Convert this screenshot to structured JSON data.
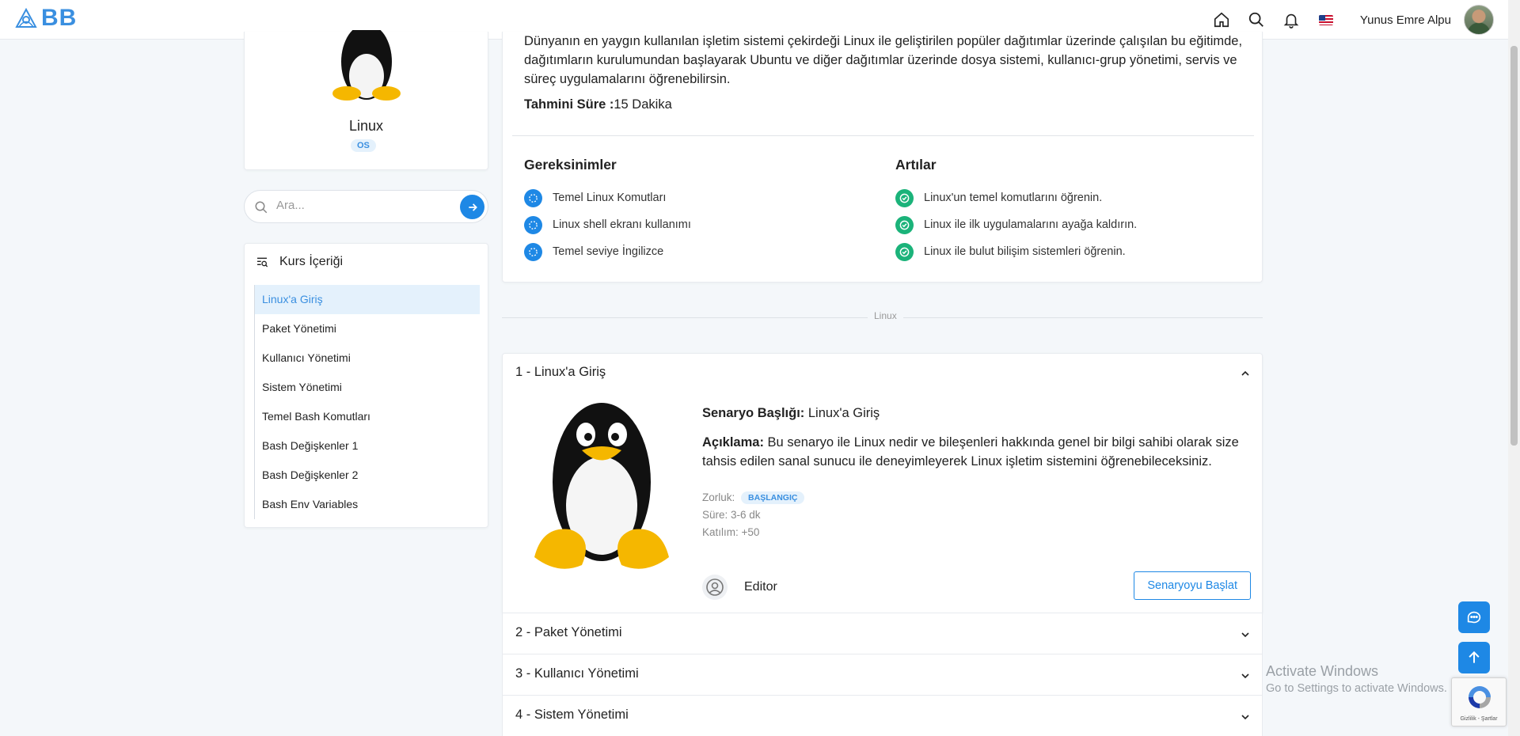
{
  "navbar": {
    "logo_text": "BB",
    "user_name": "Yunus Emre Alpu"
  },
  "course": {
    "title": "Linux",
    "badge": "OS"
  },
  "search": {
    "placeholder": "Ara..."
  },
  "content": {
    "title": "Kurs İçeriği",
    "items": [
      {
        "label": "Linux'a Giriş",
        "active": true
      },
      {
        "label": "Paket Yönetimi"
      },
      {
        "label": "Kullanıcı Yönetimi"
      },
      {
        "label": "Sistem Yönetimi"
      },
      {
        "label": "Temel Bash Komutları"
      },
      {
        "label": "Bash Değişkenler 1"
      },
      {
        "label": "Bash Değişkenler 2"
      },
      {
        "label": "Bash Env Variables"
      }
    ]
  },
  "info": {
    "description": "Dünyanın en yaygın kullanılan işletim sistemi çekirdeği Linux ile geliştirilen popüler dağıtımlar üzerinde çalışılan bu eğitimde, dağıtımların kurulumundan başlayarak Ubuntu ve diğer dağıtımlar üzerinde dosya sistemi, kullanıcı-grup yönetimi, servis ve süreç uygulamalarını öğrenebilirsin.",
    "duration_label": "Tahmini Süre :",
    "duration_value": "15 Dakika",
    "requirements_title": "Gereksinimler",
    "requirements": [
      "Temel Linux Komutları",
      "Linux shell ekranı kullanımı",
      "Temel seviye İngilizce"
    ],
    "benefits_title": "Artılar",
    "benefits": [
      "Linux'un temel komutlarını öğrenin.",
      "Linux ile ilk uygulamalarını ayağa kaldırın.",
      "Linux ile bulut bilişim sistemleri öğrenin."
    ]
  },
  "separator_label": "Linux",
  "scenario": {
    "header": "1 - Linux'a Giriş",
    "title_label": "Senaryo Başlığı:",
    "title_value": " Linux'a Giriş",
    "desc_label": "Açıklama:",
    "desc_value": " Bu senaryo ile Linux nedir ve bileşenleri hakkında genel bir bilgi sahibi olarak size tahsis edilen sanal sunucu ile deneyimleyerek Linux işletim sistemini öğrenebileceksiniz.",
    "difficulty_label": "Zorluk:",
    "difficulty_value": "BAŞLANGIÇ",
    "time": "Süre: 3-6 dk",
    "participation": "Katılım: +50",
    "author": "Editor",
    "start_button": "Senaryoyu Başlat"
  },
  "accordion": [
    "2 - Paket Yönetimi",
    "3 - Kullanıcı Yönetimi",
    "4 - Sistem Yönetimi"
  ],
  "watermark": {
    "line1": "Activate Windows",
    "line2": "Go to Settings to activate Windows."
  },
  "recaptcha_text": "Gizlilik - Şartlar",
  "colors": {
    "accent": "#1e88e5",
    "success": "#1bb37a",
    "badge_bg": "#e4f1fc"
  }
}
